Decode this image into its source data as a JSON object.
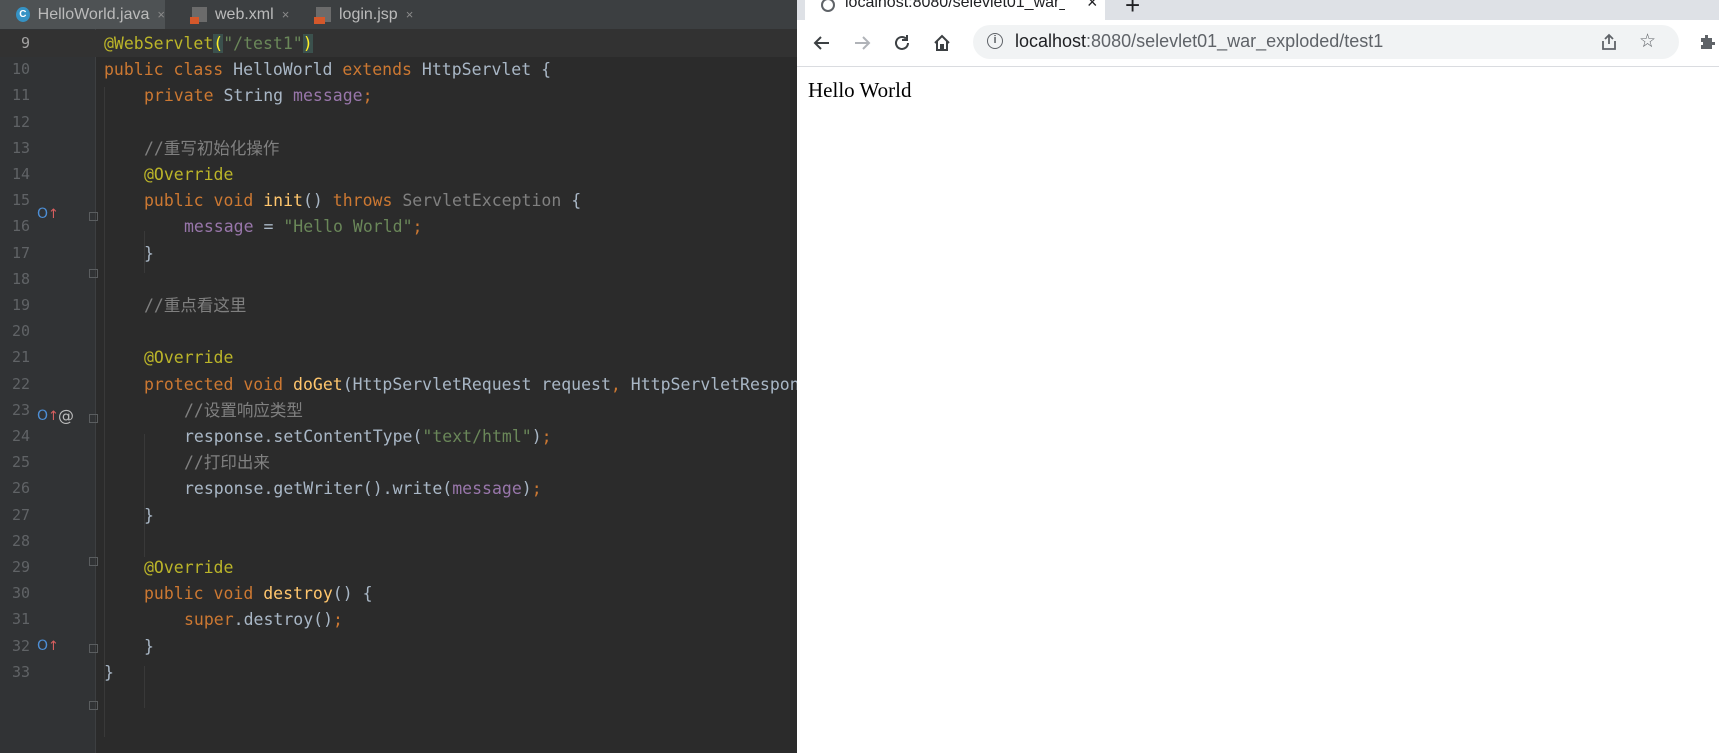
{
  "ide": {
    "tabs": [
      {
        "label": "HelloWorld.java",
        "icon": "java-class-icon",
        "active": true
      },
      {
        "label": "web.xml",
        "icon": "xml-file-icon",
        "active": false
      },
      {
        "label": "login.jsp",
        "icon": "jsp-file-icon",
        "active": false
      }
    ],
    "close_glyph": "×",
    "line_numbers": [
      "9",
      "10",
      "11",
      "12",
      "13",
      "14",
      "15",
      "16",
      "17",
      "18",
      "19",
      "20",
      "21",
      "22",
      "23",
      "24",
      "25",
      "26",
      "27",
      "28",
      "29",
      "30",
      "31",
      "32",
      "33"
    ],
    "code": {
      "l9": {
        "ann": "@WebServlet",
        "open": "(",
        "str": "\"/test1\"",
        "close": ")"
      },
      "l10": {
        "kw1": "public class ",
        "name": "HelloWorld ",
        "kw2": "extends ",
        "rest": "HttpServlet {"
      },
      "l11": {
        "kw": "private ",
        "type": "String ",
        "field": "message",
        "semi": ";"
      },
      "l13": {
        "comment": "//重写初始化操作"
      },
      "l14": {
        "ann": "@Override"
      },
      "l15": {
        "kw": "public void ",
        "fn": "init",
        "paren": "() ",
        "throws": "throws ",
        "exc": "ServletException",
        "brace": " {"
      },
      "l16": {
        "field": "message",
        "eq": " = ",
        "str": "\"Hello World\"",
        "semi": ";"
      },
      "l17": {
        "brace": "}"
      },
      "l19": {
        "comment": "//重点看这里"
      },
      "l21": {
        "ann": "@Override"
      },
      "l22": {
        "kw": "protected void ",
        "fn": "doGet",
        "args1": "(HttpServletRequest request",
        "comma": ", ",
        "args2": "HttpServletRespon"
      },
      "l23": {
        "comment": "//设置响应类型"
      },
      "l24": {
        "call": "response.setContentType(",
        "str": "\"text/html\"",
        "close": ")",
        "semi": ";"
      },
      "l25": {
        "comment": "//打印出来"
      },
      "l26": {
        "call": "response.getWriter().write(",
        "field": "message",
        "close": ")",
        "semi": ";"
      },
      "l27": {
        "brace": "}"
      },
      "l29": {
        "ann": "@Override"
      },
      "l30": {
        "kw": "public void ",
        "fn": "destroy",
        "rest": "() {"
      },
      "l31": {
        "kw": "super",
        "rest": ".destroy()",
        "semi": ";"
      },
      "l32": {
        "brace": "}"
      },
      "l33": {
        "brace": "}"
      }
    },
    "gutter_at_icon": "@"
  },
  "browser": {
    "tab_title": "localhost:8080/selevlet01_war_",
    "tab_close": "×",
    "new_tab": "+",
    "url_host": "localhost",
    "url_rest": ":8080/selevlet01_war_exploded/test1",
    "page_text": "Hello World"
  },
  "colors": {
    "editor_bg": "#2b2b2b",
    "keyword": "#cc7832",
    "string": "#6a8759",
    "annotation": "#bbb529",
    "field": "#9876aa",
    "function": "#ffc66d"
  }
}
